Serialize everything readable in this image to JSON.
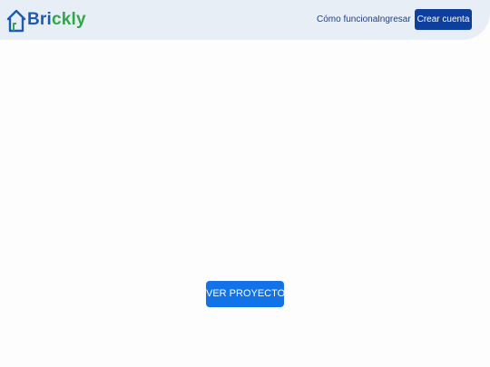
{
  "header": {
    "logo": {
      "text_part1": "Bri",
      "text_part2": "ckly",
      "icon": "house-icon",
      "color_primary": "#1d5bb3",
      "color_secondary": "#2ea84a"
    },
    "nav": {
      "how_it_works": "Cómo funciona",
      "login": "Ingresar",
      "create_account": "Crear cuenta"
    },
    "background": "#e8eef5"
  },
  "main": {
    "cta_label": "VER PROYECTOS",
    "cta_color": "#1273e8"
  },
  "colors": {
    "nav_text": "#1d3f8a",
    "create_button": "#0f3f9c"
  }
}
